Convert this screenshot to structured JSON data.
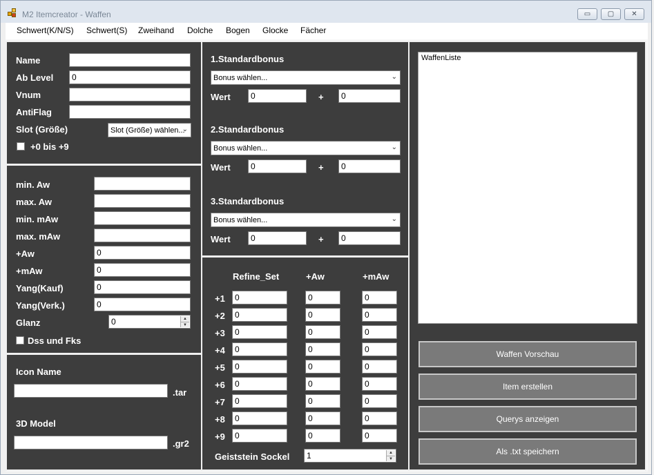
{
  "window": {
    "title": "M2 Itemcreator - Waffen",
    "minimize": "▭",
    "maximize": "▢",
    "close": "✕",
    "icon": "app-grid-icon"
  },
  "menu": [
    "Schwert(K/N/S)",
    "Schwert(S)",
    "Zweihand",
    "Dolche",
    "Bogen",
    "Glocke",
    "Fächer"
  ],
  "basic": {
    "name_label": "Name",
    "name_value": "",
    "level_label": "Ab Level",
    "level_value": "0",
    "vnum_label": "Vnum",
    "vnum_value": "",
    "antiflag_label": "AntiFlag",
    "antiflag_value": "",
    "slot_label": "Slot (Größe)",
    "slot_value": "Slot (Größe) wählen...",
    "plus_label": "+0 bis +9"
  },
  "stats": {
    "rows": [
      {
        "label": "min. Aw",
        "value": ""
      },
      {
        "label": "max. Aw",
        "value": ""
      },
      {
        "label": "min. mAw",
        "value": ""
      },
      {
        "label": "max. mAw",
        "value": ""
      },
      {
        "label": "+Aw",
        "value": "0"
      },
      {
        "label": "+mAw",
        "value": "0"
      },
      {
        "label": "Yang(Kauf)",
        "value": "0"
      },
      {
        "label": "Yang(Verk.)",
        "value": "0"
      }
    ],
    "glanz_label": "Glanz",
    "glanz_value": "0",
    "dss_label": "Dss und Fks"
  },
  "files": {
    "icon_label": "Icon Name",
    "icon_value": "",
    "icon_ext": ".tar",
    "model_label": "3D Model",
    "model_value": "",
    "model_ext": ".gr2"
  },
  "bonus": [
    {
      "title": "1.Standardbonus",
      "select": "Bonus wählen...",
      "wert_label": "Wert",
      "value": "0",
      "plus": "+",
      "value2": "0"
    },
    {
      "title": "2.Standardbonus",
      "select": "Bonus wählen...",
      "wert_label": "Wert",
      "value": "0",
      "plus": "+",
      "value2": "0"
    },
    {
      "title": "3.Standardbonus",
      "select": "Bonus wählen...",
      "wert_label": "Wert",
      "value": "0",
      "plus": "+",
      "value2": "0"
    }
  ],
  "refine": {
    "headers": [
      "Refine_Set",
      "+Aw",
      "+mAw"
    ],
    "rows": [
      {
        "label": "+1",
        "set": "0",
        "aw": "0",
        "maw": "0"
      },
      {
        "label": "+2",
        "set": "0",
        "aw": "0",
        "maw": "0"
      },
      {
        "label": "+3",
        "set": "0",
        "aw": "0",
        "maw": "0"
      },
      {
        "label": "+4",
        "set": "0",
        "aw": "0",
        "maw": "0"
      },
      {
        "label": "+5",
        "set": "0",
        "aw": "0",
        "maw": "0"
      },
      {
        "label": "+6",
        "set": "0",
        "aw": "0",
        "maw": "0"
      },
      {
        "label": "+7",
        "set": "0",
        "aw": "0",
        "maw": "0"
      },
      {
        "label": "+8",
        "set": "0",
        "aw": "0",
        "maw": "0"
      },
      {
        "label": "+9",
        "set": "0",
        "aw": "0",
        "maw": "0"
      }
    ],
    "sockel_label": "Geiststein Sockel",
    "sockel_value": "1"
  },
  "list": {
    "text": "WaffenListe"
  },
  "buttons": [
    "Waffen Vorschau",
    "Item erstellen",
    "Querys anzeigen",
    "Als .txt speichern"
  ],
  "colors": {
    "panel": "#3d3d3d",
    "button": "#7a7a7a",
    "titlebar": "#dfe6ef"
  }
}
